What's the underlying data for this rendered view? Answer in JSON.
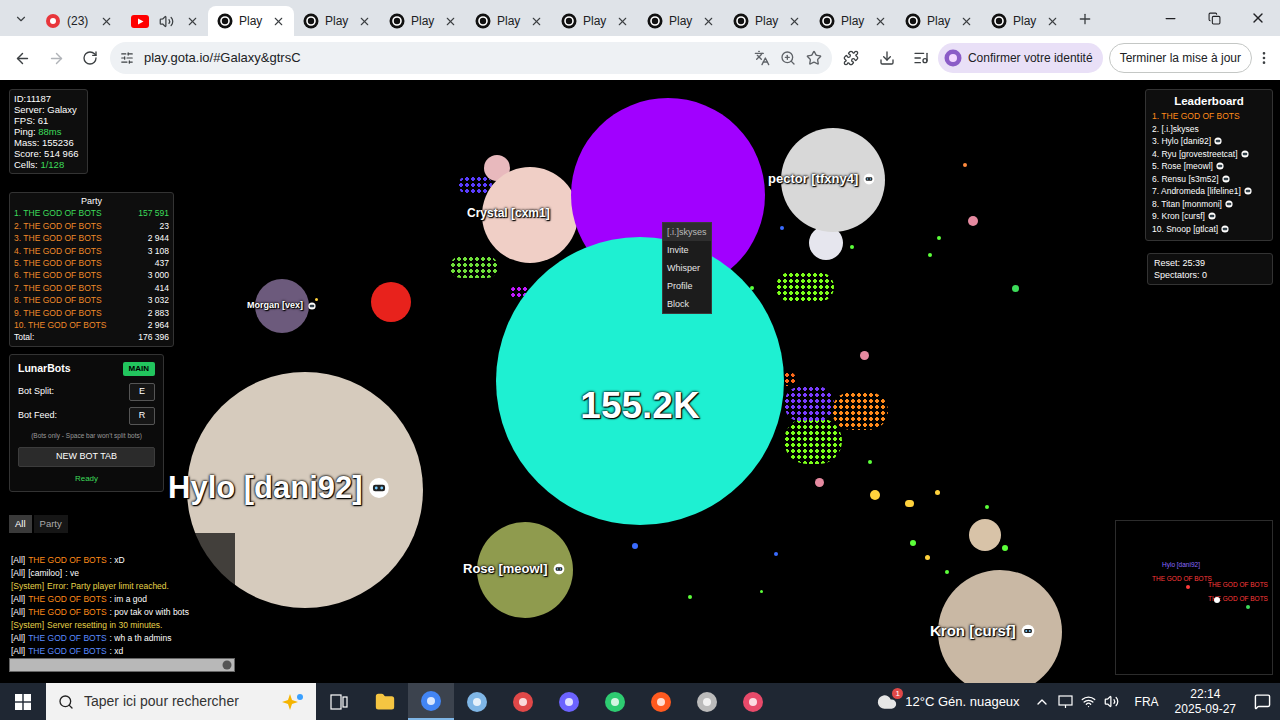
{
  "browser": {
    "tabs": [
      {
        "label": "(23)",
        "kind": "badge",
        "selected": false
      },
      {
        "label": "",
        "kind": "audio",
        "selected": false
      },
      {
        "label": "Play",
        "kind": "game",
        "selected": true
      },
      {
        "label": "Play",
        "kind": "game",
        "selected": false
      },
      {
        "label": "Play",
        "kind": "game",
        "selected": false
      },
      {
        "label": "Play",
        "kind": "game",
        "selected": false
      },
      {
        "label": "Play",
        "kind": "game",
        "selected": false
      },
      {
        "label": "Play",
        "kind": "game",
        "selected": false
      },
      {
        "label": "Play",
        "kind": "game",
        "selected": false
      },
      {
        "label": "Play",
        "kind": "game",
        "selected": false
      },
      {
        "label": "Play",
        "kind": "game",
        "selected": false
      },
      {
        "label": "Play",
        "kind": "game",
        "selected": false
      }
    ],
    "url": "play.gota.io/#Galaxy&gtrsC",
    "identity_button": "Confirmer votre identité",
    "update_button": "Terminer la mise à jour"
  },
  "stats": [
    {
      "label": "ID:",
      "value": "11187",
      "color": "#ffffff"
    },
    {
      "label": "Server: ",
      "value": "Galaxy",
      "color": "#ffffff"
    },
    {
      "label": "FPS: ",
      "value": "61",
      "color": "#ffffff"
    },
    {
      "label": "Ping: ",
      "value": "88ms",
      "color": "#3ddc5a"
    },
    {
      "label": "Mass: ",
      "value": "155236",
      "color": "#ffffff"
    },
    {
      "label": "Score: ",
      "value": "514 966",
      "color": "#ffffff"
    },
    {
      "label": "Cells: ",
      "value": "1/128",
      "color": "#3ddc5a"
    }
  ],
  "party": {
    "title": "Party",
    "rows": [
      {
        "rank": "1.",
        "name": "THE GOD OF BOTS",
        "mass": "157 591",
        "selected": true
      },
      {
        "rank": "2.",
        "name": "THE GOD OF BOTS",
        "mass": "23",
        "selected": false
      },
      {
        "rank": "3.",
        "name": "THE GOD OF BOTS",
        "mass": "2 944",
        "selected": false
      },
      {
        "rank": "4.",
        "name": "THE GOD OF BOTS",
        "mass": "3 108",
        "selected": false
      },
      {
        "rank": "5.",
        "name": "THE GOD OF BOTS",
        "mass": "437",
        "selected": false
      },
      {
        "rank": "6.",
        "name": "THE GOD OF BOTS",
        "mass": "3 000",
        "selected": false
      },
      {
        "rank": "7.",
        "name": "THE GOD OF BOTS",
        "mass": "414",
        "selected": false
      },
      {
        "rank": "8.",
        "name": "THE GOD OF BOTS",
        "mass": "3 032",
        "selected": false
      },
      {
        "rank": "9.",
        "name": "THE GOD OF BOTS",
        "mass": "2 883",
        "selected": false
      },
      {
        "rank": "10.",
        "name": "THE GOD OF BOTS",
        "mass": "2 964",
        "selected": false
      }
    ],
    "total_label": "Total:",
    "total": "176 396"
  },
  "lunarbots": {
    "title": "LunarBots",
    "badge": "MAIN",
    "binds": [
      {
        "label": "Bot Split:",
        "key": "E"
      },
      {
        "label": "Bot Feed:",
        "key": "R"
      }
    ],
    "note": "(Bots only - Space bar won't split bots)",
    "button": "NEW BOT TAB",
    "status": "Ready"
  },
  "chat": {
    "tabs": [
      {
        "label": "All",
        "selected": true
      },
      {
        "label": "Party",
        "selected": false
      }
    ],
    "messages": [
      {
        "channel": "[All]",
        "name": "THE GOD OF BOTS",
        "text": ": xD",
        "color": "#ff8c1a"
      },
      {
        "channel": "[All]",
        "name": "[camiloo]",
        "text": ": ve",
        "color": "#ffffff"
      },
      {
        "channel": "[System]",
        "name": "",
        "text": "Error: Party player limit reached.",
        "color": "#e6d34a"
      },
      {
        "channel": "[All]",
        "name": "THE GOD OF BOTS",
        "text": ": im a god",
        "color": "#ff8c1a"
      },
      {
        "channel": "[All]",
        "name": "THE GOD OF BOTS",
        "text": ": pov tak ov with bots",
        "color": "#ff8c1a"
      },
      {
        "channel": "[System]",
        "name": "",
        "text": "Server resetting in 30 minutes.",
        "color": "#e6d34a"
      },
      {
        "channel": "[All]",
        "name": "THE GOD OF BOTS",
        "text": ": wh a th admins",
        "color": "#5b8cff"
      },
      {
        "channel": "[All]",
        "name": "THE GOD OF BOTS",
        "text": ": xd",
        "color": "#5b8cff"
      }
    ]
  },
  "leaderboard": {
    "title": "Leaderboard",
    "entries": [
      {
        "rank": "1.",
        "name": "THE GOD OF BOTS",
        "color": "#ff8c1a",
        "badge": false
      },
      {
        "rank": "2.",
        "name": "[.i.]skyses",
        "color": "#ffffff",
        "badge": false
      },
      {
        "rank": "3.",
        "name": "Hylo [dani92]",
        "color": "#ffffff",
        "badge": true
      },
      {
        "rank": "4.",
        "name": "Ryu [grovestreetcat]",
        "color": "#ffffff",
        "badge": true
      },
      {
        "rank": "5.",
        "name": "Rose [meowl]",
        "color": "#ffffff",
        "badge": true
      },
      {
        "rank": "6.",
        "name": "Rensu [s3m52]",
        "color": "#ffffff",
        "badge": true
      },
      {
        "rank": "7.",
        "name": "Andromeda [lifeline1]",
        "color": "#ffffff",
        "badge": true
      },
      {
        "rank": "8.",
        "name": "Titan [monmoni]",
        "color": "#ffffff",
        "badge": true
      },
      {
        "rank": "9.",
        "name": "Kron [cursf]",
        "color": "#ffffff",
        "badge": true
      },
      {
        "rank": "10.",
        "name": "Snoop [gtlcat]",
        "color": "#ffffff",
        "badge": true
      }
    ]
  },
  "server_info": {
    "reset": "Reset: 25:39",
    "spectators": "Spectators: 0"
  },
  "canvas": {
    "main_cell": {
      "mass": "155.2K",
      "color": "#1ef0d2"
    },
    "purple_cell": {
      "color": "#a100ff"
    },
    "pellet": {
      "color": "#e8221c"
    },
    "players": [
      {
        "name": "Hylo [dani92]",
        "color": "#d6cbbd",
        "badge": true
      },
      {
        "name": "Rose [meowl]",
        "color": "#8f9b4e",
        "badge": true
      },
      {
        "name": "Kron [cursf]",
        "color": "#c9b8a4",
        "badge": true
      },
      {
        "name": "pector [tfxny4]",
        "color": "#d8d8d8",
        "badge": true
      },
      {
        "name": "Crystal [cxm1]",
        "color": "#f0cfc6",
        "badge": false
      },
      {
        "name": "Morgan [vex]",
        "color": "#6c5a7c",
        "badge": true
      }
    ],
    "context_menu": {
      "title": "[.i.]skyses",
      "items": [
        "Invite",
        "Whisper",
        "Profile",
        "Block"
      ]
    },
    "minimap": {
      "labels": [
        {
          "text": "Hylo [dani92]",
          "color": "#8a6bff"
        },
        {
          "text": "THE GOD OF BOTS",
          "color": "#ff3b3b"
        },
        {
          "text": "THE GOD OF BOTS",
          "color": "#ff3b3b"
        },
        {
          "text": "THE GOD OF BOTS",
          "color": "#ff3b3b"
        }
      ]
    }
  },
  "taskbar": {
    "search_placeholder": "Taper ici pour rechercher",
    "weather_badge": "1",
    "weather": "12°C Gén. nuageux",
    "language": "FRA",
    "time": "22:14",
    "date": "2025-09-27"
  }
}
